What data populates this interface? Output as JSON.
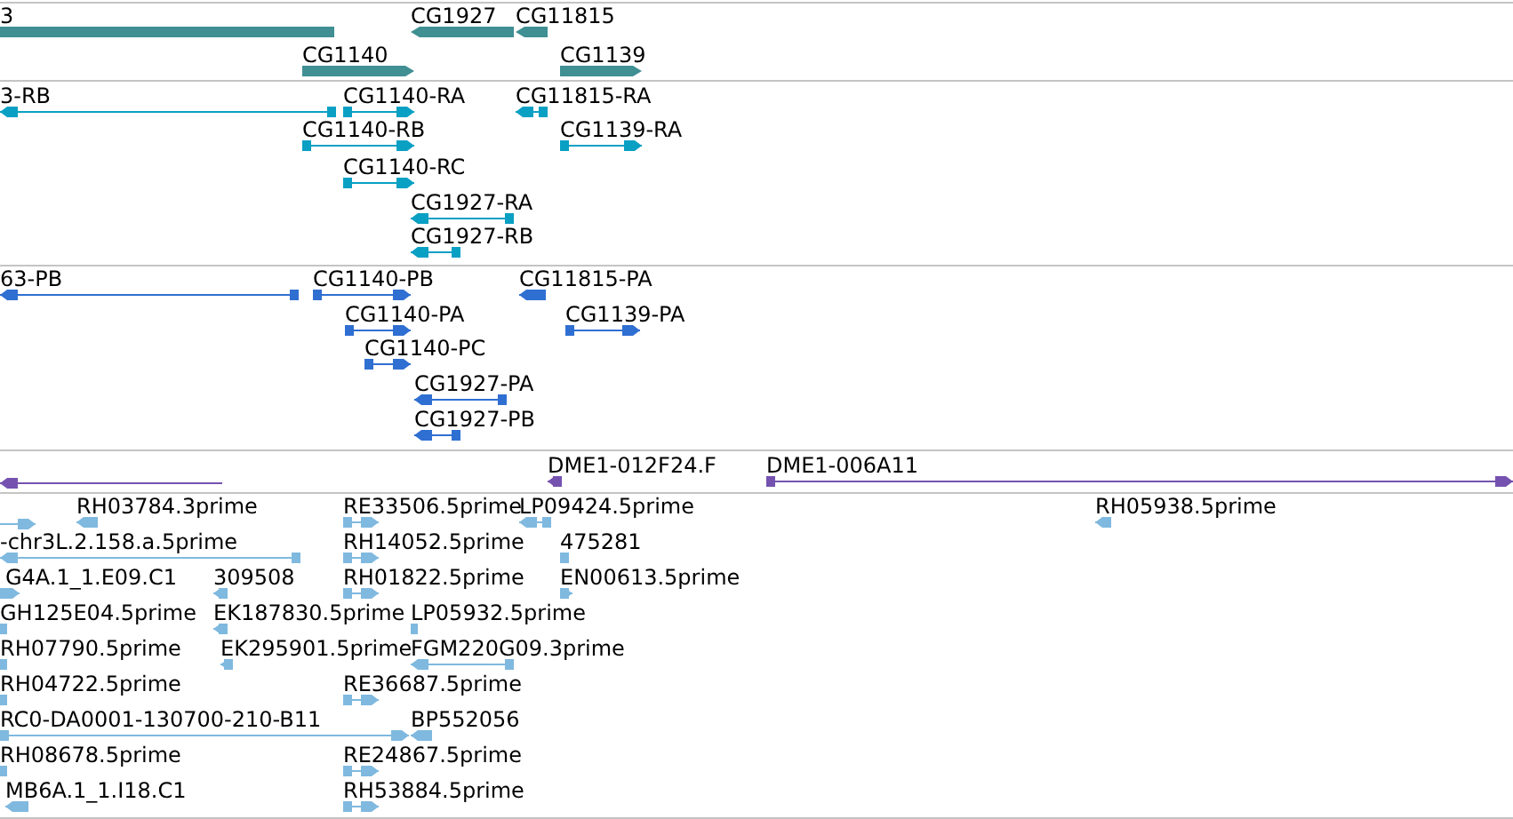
{
  "tracks": [
    {
      "features": [
        {
          "label": "3"
        },
        {
          "label": "CG1927"
        },
        {
          "label": "CG11815"
        },
        {
          "label": "CG1140"
        },
        {
          "label": "CG1139"
        }
      ]
    },
    {
      "features": [
        {
          "label": "3-RB"
        },
        {
          "label": "CG1140-RA"
        },
        {
          "label": "CG11815-RA"
        },
        {
          "label": "CG1140-RB"
        },
        {
          "label": "CG1139-RA"
        },
        {
          "label": "CG1140-RC"
        },
        {
          "label": "CG1927-RA"
        },
        {
          "label": "CG1927-RB"
        }
      ]
    },
    {
      "features": [
        {
          "label": "63-PB"
        },
        {
          "label": "CG1140-PB"
        },
        {
          "label": "CG11815-PA"
        },
        {
          "label": "CG1140-PA"
        },
        {
          "label": "CG1139-PA"
        },
        {
          "label": "CG1140-PC"
        },
        {
          "label": "CG1927-PA"
        },
        {
          "label": "CG1927-PB"
        }
      ]
    },
    {
      "features": [
        {
          "kind": "unlabeled"
        },
        {
          "label": "DME1-012F24.F"
        },
        {
          "label": "DME1-006A11"
        }
      ]
    },
    {
      "features": [
        {
          "kind": "unlabeled"
        },
        {
          "label": "RH03784.3prime"
        },
        {
          "label": "RE33506.5prime"
        },
        {
          "label": "LP09424.5prime"
        },
        {
          "label": "RH05938.5prime"
        },
        {
          "label": "-chr3L.2.158.a.5prime"
        },
        {
          "label": "RH14052.5prime"
        },
        {
          "label": "475281"
        },
        {
          "label": "G4A.1_1.E09.C1"
        },
        {
          "label": "309508"
        },
        {
          "label": "RH01822.5prime"
        },
        {
          "label": "EN00613.5prime"
        },
        {
          "label": "GH125E04.5prime"
        },
        {
          "label": "EK187830.5prime"
        },
        {
          "label": "LP05932.5prime"
        },
        {
          "label": "RH07790.5prime"
        },
        {
          "label": "EK295901.5prime"
        },
        {
          "label": "FGM220G09.3prime"
        },
        {
          "label": "RH04722.5prime"
        },
        {
          "label": "RE36687.5prime"
        },
        {
          "label": "RC0-DA0001-130700-210-B11"
        },
        {
          "label": "BP552056"
        },
        {
          "label": "RH08678.5prime"
        },
        {
          "label": "RE24867.5prime"
        },
        {
          "label": "MB6A.1_1.I18.C1"
        },
        {
          "label": "RH53884.5prime"
        }
      ]
    }
  ]
}
